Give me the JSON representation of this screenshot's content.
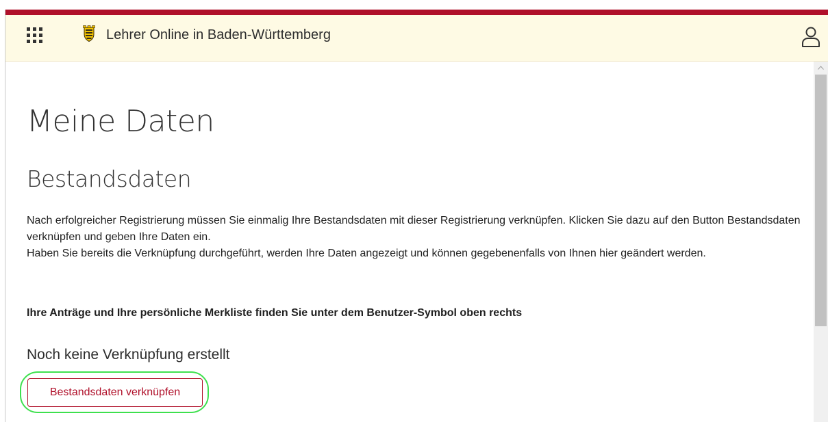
{
  "colors": {
    "brand_red": "#b0102a",
    "header_background": "#fefae4",
    "highlight_green": "#3ee04e"
  },
  "header": {
    "menu_icon": "app-grid-icon",
    "logo_icon": "baden-wuerttemberg-crest-icon",
    "app_title": "Lehrer Online in Baden-Württemberg",
    "user_icon": "user-icon"
  },
  "main": {
    "page_title": "Meine Daten",
    "section_title": "Bestandsdaten",
    "paragraph_1": "Nach erfolgreicher Registrierung müssen Sie einmalig Ihre Bestandsdaten mit dieser Registrierung verknüpfen. Klicken Sie dazu auf den Button Bestandsdaten verknüpfen und geben Ihre Daten ein.",
    "paragraph_2": "Haben Sie bereits die Verknüpfung durchgeführt, werden Ihre Daten angezeigt und können gegebenenfalls von Ihnen hier geändert werden.",
    "paragraph_bold": "Ihre Anträge und Ihre persönliche Merkliste finden Sie unter dem Benutzer-Symbol oben rechts",
    "status_text": "Noch keine Verknüpfung erstellt",
    "link_button_label": "Bestandsdaten verknüpfen"
  },
  "scrollbar": {
    "up_icon": "chevron-up-icon"
  }
}
